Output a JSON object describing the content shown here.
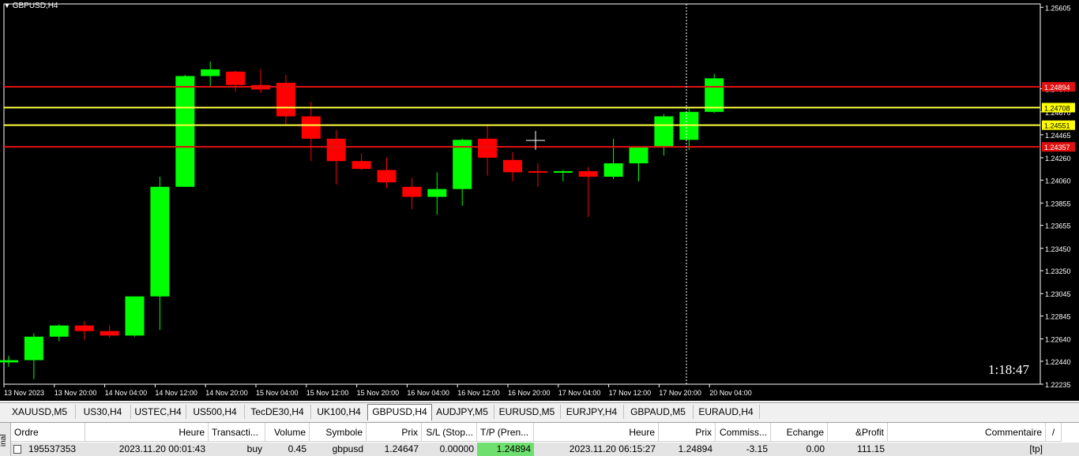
{
  "window": {
    "title": "GBPUSD,H4",
    "timer": "1:18:47"
  },
  "chart_data": {
    "type": "candlestick",
    "symbol": "GBPUSD",
    "timeframe": "H4",
    "price_range": [
      1.22235,
      1.25635
    ],
    "price_ticks": [
      "1.25605",
      "1.24877",
      "1.24670",
      "1.24465",
      "1.24260",
      "1.24060",
      "1.23855",
      "1.23655",
      "1.23450",
      "1.23250",
      "1.23045",
      "1.22845",
      "1.22640",
      "1.22440",
      "1.22235"
    ],
    "time_labels": [
      "13 Nov 2023",
      "13 Nov 20:00",
      "14 Nov 04:00",
      "14 Nov 12:00",
      "14 Nov 20:00",
      "15 Nov 04:00",
      "15 Nov 12:00",
      "15 Nov 20:00",
      "16 Nov 04:00",
      "16 Nov 12:00",
      "16 Nov 20:00",
      "17 Nov 04:00",
      "17 Nov 12:00",
      "17 Nov 20:00",
      "20 Nov 04:00"
    ],
    "candles": [
      {
        "o": 1.2243,
        "h": 1.2249,
        "l": 1.2239,
        "c": 1.2245
      },
      {
        "o": 1.2245,
        "h": 1.2269,
        "l": 1.2228,
        "c": 1.2266
      },
      {
        "o": 1.2266,
        "h": 1.2277,
        "l": 1.2262,
        "c": 1.2276
      },
      {
        "o": 1.2276,
        "h": 1.228,
        "l": 1.2263,
        "c": 1.2271
      },
      {
        "o": 1.2271,
        "h": 1.2276,
        "l": 1.2265,
        "c": 1.2267
      },
      {
        "o": 1.2267,
        "h": 1.2302,
        "l": 1.2266,
        "c": 1.2302
      },
      {
        "o": 1.2302,
        "h": 1.2409,
        "l": 1.2272,
        "c": 1.24
      },
      {
        "o": 1.24,
        "h": 1.25,
        "l": 1.24,
        "c": 1.2499
      },
      {
        "o": 1.2499,
        "h": 1.2512,
        "l": 1.2489,
        "c": 1.2505
      },
      {
        "o": 1.2503,
        "h": 1.2504,
        "l": 1.2485,
        "c": 1.2491
      },
      {
        "o": 1.2491,
        "h": 1.2505,
        "l": 1.2484,
        "c": 1.2487
      },
      {
        "o": 1.2493,
        "h": 1.25,
        "l": 1.2455,
        "c": 1.2463
      },
      {
        "o": 1.2463,
        "h": 1.2476,
        "l": 1.2423,
        "c": 1.2443
      },
      {
        "o": 1.2443,
        "h": 1.2451,
        "l": 1.2402,
        "c": 1.2423
      },
      {
        "o": 1.2423,
        "h": 1.243,
        "l": 1.2415,
        "c": 1.2416
      },
      {
        "o": 1.2415,
        "h": 1.2426,
        "l": 1.2399,
        "c": 1.2404
      },
      {
        "o": 1.24,
        "h": 1.2408,
        "l": 1.238,
        "c": 1.2391
      },
      {
        "o": 1.2391,
        "h": 1.2413,
        "l": 1.2375,
        "c": 1.2398
      },
      {
        "o": 1.2398,
        "h": 1.2443,
        "l": 1.2383,
        "c": 1.2442
      },
      {
        "o": 1.2443,
        "h": 1.2456,
        "l": 1.241,
        "c": 1.2426
      },
      {
        "o": 1.2424,
        "h": 1.2431,
        "l": 1.2405,
        "c": 1.2413
      },
      {
        "o": 1.2414,
        "h": 1.2421,
        "l": 1.24,
        "c": 1.2413
      },
      {
        "o": 1.2413,
        "h": 1.2415,
        "l": 1.2405,
        "c": 1.2414
      },
      {
        "o": 1.2414,
        "h": 1.2418,
        "l": 1.2373,
        "c": 1.2409
      },
      {
        "o": 1.2409,
        "h": 1.2443,
        "l": 1.2407,
        "c": 1.2421
      },
      {
        "o": 1.2421,
        "h": 1.2434,
        "l": 1.2405,
        "c": 1.2436
      },
      {
        "o": 1.2436,
        "h": 1.2465,
        "l": 1.2428,
        "c": 1.2463
      },
      {
        "o": 1.2442,
        "h": 1.247,
        "l": 1.2433,
        "c": 1.2467
      },
      {
        "o": 1.2467,
        "h": 1.2501,
        "l": 1.2466,
        "c": 1.2497
      }
    ],
    "hlines": [
      {
        "price": 1.24894,
        "label": "1.24894",
        "color": "#e01010",
        "label_bg": "#e01010",
        "label_color": "#ffffff"
      },
      {
        "price": 1.24708,
        "label": "1.24708",
        "color": "#ffff40",
        "label_bg": "#ffff00",
        "label_color": "#000000"
      },
      {
        "price": 1.24551,
        "label": "1.24551",
        "color": "#ffff40",
        "label_bg": "#ffff00",
        "label_color": "#000000"
      },
      {
        "price": 1.24357,
        "label": "1.24357",
        "color": "#e01010",
        "label_bg": "#e01010",
        "label_color": "#ffffff"
      }
    ],
    "bull_color": "#00ff00",
    "bear_color": "#ff0000"
  },
  "tabs": [
    "XAUUSD,M5",
    "US30,H4",
    "USTEC,H4",
    "US500,H4",
    "TecDE30,H4",
    "UK100,H4",
    "GBPUSD,H4",
    "AUDJPY,M5",
    "EURUSD,M5",
    "EURJPY,H4",
    "GBPAUD,M5",
    "EURAUD,H4"
  ],
  "active_tab": "GBPUSD,H4",
  "terminal": {
    "side_label": "inal",
    "columns": [
      "Ordre",
      "Heure",
      "Transacti...",
      "Volume",
      "Symbole",
      "Prix",
      "S/L (Stop...",
      "T/P (Pren...",
      "Heure",
      "Prix",
      "Commiss...",
      "Echange",
      "&Profit",
      "Commentaire"
    ],
    "row": [
      "195537353",
      "2023.11.20 00:01:43",
      "buy",
      "0.45",
      "gbpusd",
      "1.24647",
      "0.00000",
      "1.24894",
      "2023.11.20 06:15:27",
      "1.24894",
      "-3.15",
      "0.00",
      "111.15",
      "[tp]"
    ]
  }
}
